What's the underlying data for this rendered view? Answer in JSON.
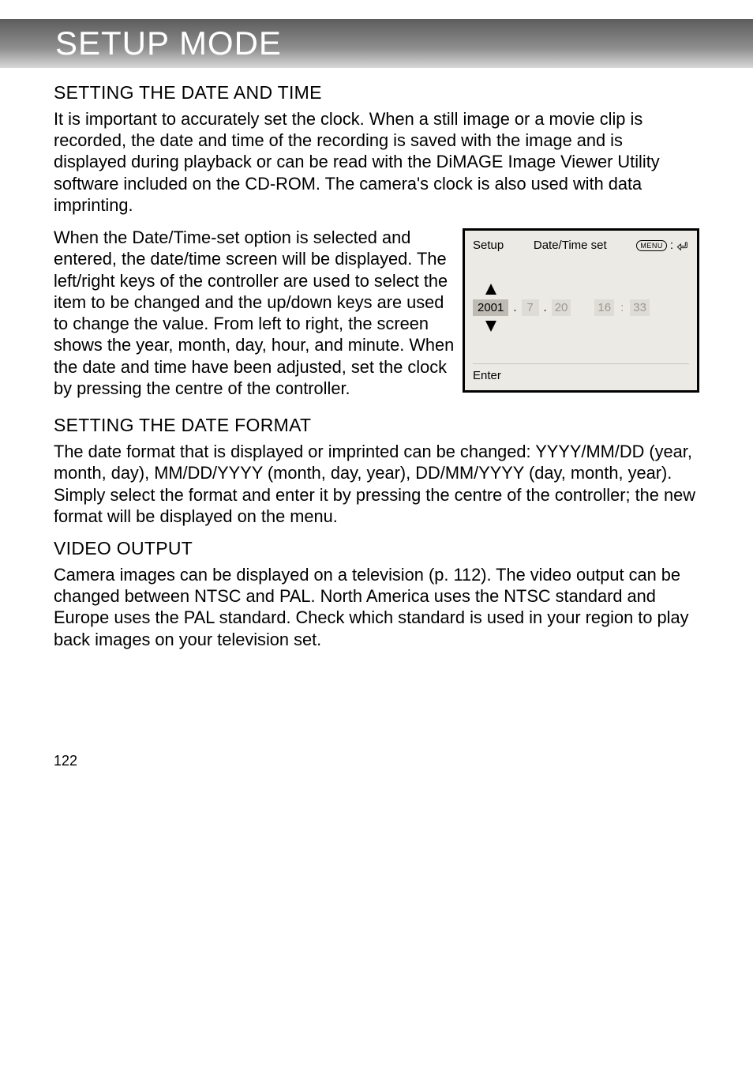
{
  "header": {
    "title": "SETUP MODE"
  },
  "sections": {
    "date_time": {
      "heading": "SETTING THE DATE AND TIME",
      "p1": "It is important to accurately set the clock. When a still image or a movie clip is recorded, the date and time of the recording is saved with the image and is displayed during playback or can be read with the DiMAGE Image Viewer Utility software included on the CD-ROM. The camera's clock is also used with data imprinting.",
      "p2": "When the Date/Time-set option is selected and entered, the date/time screen will be displayed. The left/right keys of the controller are used to select the item to be changed and the up/down keys are used to change the value. From left to right, the screen shows the year, month, day, hour, and minute. When the date and time have been adjusted, set the clock by pressing the centre of the controller."
    },
    "date_format": {
      "heading": "SETTING THE DATE FORMAT",
      "p": "The date format that is displayed or imprinted can be changed: YYYY/MM/DD (year, month, day), MM/DD/YYYY (month, day, year), DD/MM/YYYY (day, month, year). Simply select the format and enter it by pressing the centre of the controller; the new format will be displayed on the menu."
    },
    "video_output": {
      "heading": "VIDEO OUTPUT",
      "p": "Camera images can be displayed on a television (p. 112). The video output can be changed between NTSC and PAL. North America uses the NTSC standard and Europe uses the PAL standard. Check which standard is used in your region to play back images on your television set."
    }
  },
  "lcd": {
    "setup_label": "Setup",
    "title": "Date/Time set",
    "menu_label": "MENU",
    "year": "2001",
    "month": "7",
    "day": "20",
    "hour": "16",
    "minute": "33",
    "enter_label": "Enter"
  },
  "page_number": "122"
}
